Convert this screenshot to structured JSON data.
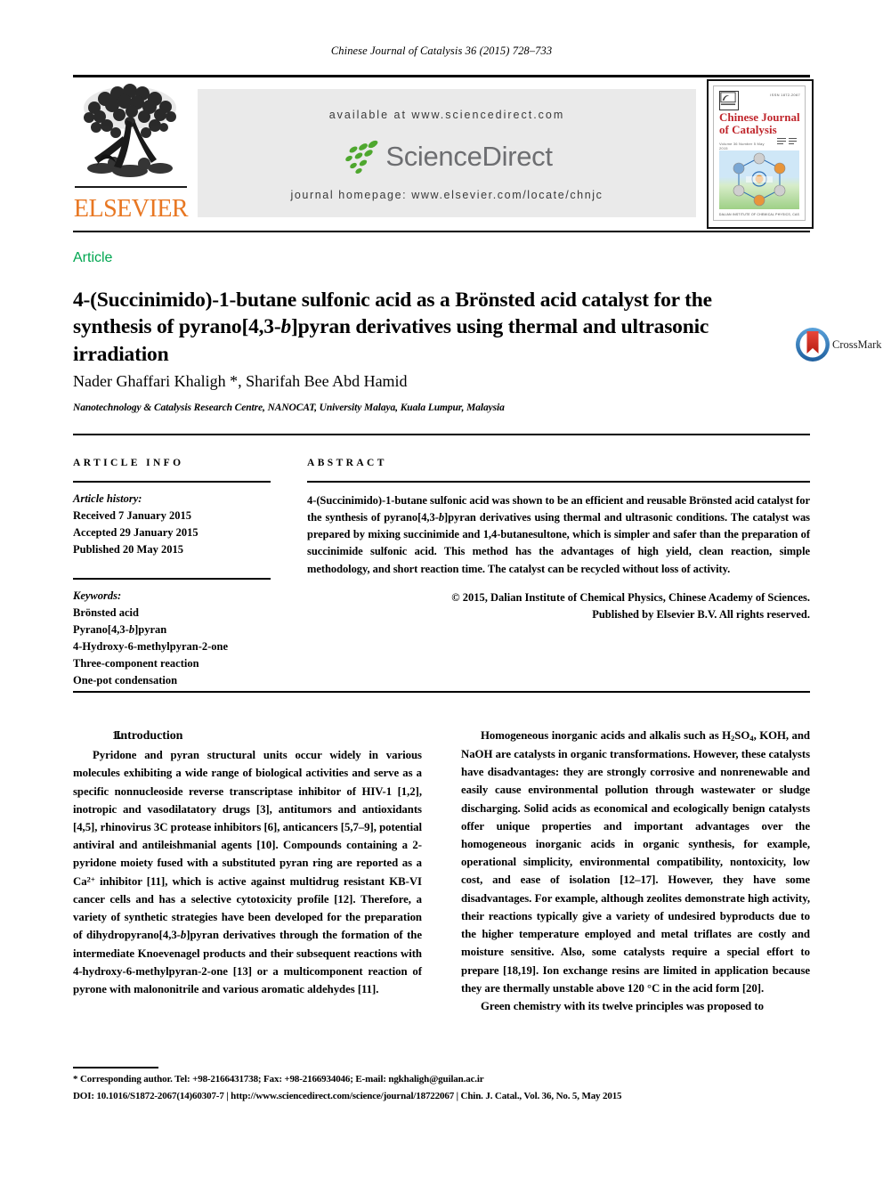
{
  "running_head": "Chinese Journal of Catalysis 36 (2015) 728–733",
  "masthead": {
    "publisher_name": "ELSEVIER",
    "available_at": "available at www.sciencedirect.com",
    "sciencedirect_wordmark": "ScienceDirect",
    "journal_homepage": "journal homepage: www.elsevier.com/locate/chnjc",
    "cover": {
      "title_line1": "Chinese Journal",
      "title_line2": "of Catalysis",
      "issue_line": "Volume 36  Number 5  May 2015",
      "top_right": "ISSN 1872-2067",
      "footer": "DALIAN INSTITUTE OF CHEMICAL PHYSICS, CAS"
    }
  },
  "article": {
    "type_label": "Article",
    "title_part1": "4-(Succinimido)-1-butane sulfonic acid as a Brönsted acid catalyst for the synthesis of pyrano[4,3-",
    "title_italic": "b",
    "title_part2": "]pyran derivatives using thermal and ultrasonic irradiation",
    "crossmark_label": "CrossMark",
    "authors": "Nader Ghaffari Khaligh *, Sharifah Bee Abd Hamid",
    "affiliation": "Nanotechnology & Catalysis Research Centre, NANOCAT, University Malaya, Kuala Lumpur, Malaysia"
  },
  "article_info": {
    "heading": "ARTICLE INFO",
    "history_label": "Article history:",
    "history": [
      "Received 7 January 2015",
      "Accepted 29 January 2015",
      "Published 20 May 2015"
    ],
    "keywords_label": "Keywords:",
    "keywords": [
      "Brönsted acid",
      "Pyrano[4,3-b]pyran",
      "4-Hydroxy-6-methylpyran-2-one",
      "Three-component reaction",
      "One-pot condensation"
    ]
  },
  "abstract": {
    "heading": "ABSTRACT",
    "body_part1": "4-(Succinimido)-1-butane sulfonic acid was shown to be an efficient and reusable Brönsted acid catalyst for the synthesis of pyrano[4,3-",
    "body_italic": "b",
    "body_part2": "]pyran derivatives using thermal and ultrasonic conditions. The catalyst was prepared by mixing succinimide and 1,4-butanesultone, which is simpler and safer than the preparation of succinimide sulfonic acid. This method has the advantages of high yield, clean reaction, simple methodology, and short reaction time. The catalyst can be recycled without loss of activity.",
    "copyright_line1": "© 2015, Dalian Institute of Chemical Physics, Chinese Academy of Sciences.",
    "copyright_line2": "Published by Elsevier B.V. All rights reserved."
  },
  "sections": {
    "intro_number": "1.",
    "intro_title": "Introduction"
  },
  "body": {
    "left_p1_a": "Pyridone and pyran structural units occur widely in various molecules exhibiting a wide range of biological activities and serve as a specific nonnucleoside reverse transcriptase inhibitor of HIV-1 [1,2], inotropic and vasodilatatory drugs [3], antitumors and antioxidants [4,5], rhinovirus 3C protease inhibitors [6], anticancers [5,7–9], potential antiviral and antileishmanial agents [10]. Compounds containing a 2-pyridone moiety fused with a substituted pyran ring are reported as a Ca",
    "left_p1_sup": "2+",
    "left_p1_b": " inhibitor [11], which is active against multidrug resistant KB-VI cancer cells and has a selective cytotoxicity profile [12]. Therefore, a variety of synthetic strategies have been developed for the preparation of dihydropyrano[4,3-",
    "left_p1_italic": "b",
    "left_p1_c": "]pyran derivatives through the formation of the intermediate Knoevenagel products and their subsequent reactions with 4-hydroxy-6-methylpyran-2-one [13] or a multicomponent reaction of pyrone with malononitrile and various aromatic aldehydes [11].",
    "right_p1_a": "Homogeneous inorganic acids and alkalis such as H",
    "right_p1_sub1": "2",
    "right_p1_b": "SO",
    "right_p1_sub2": "4",
    "right_p1_c": ", KOH, and NaOH are catalysts in organic transformations. However, these catalysts have disadvantages: they are strongly corrosive and nonrenewable and easily cause environmental pollution through wastewater or sludge discharging. Solid acids as economical and ecologically benign catalysts offer unique properties and important advantages over the homogeneous inorganic acids in organic synthesis, for example, operational simplicity, environmental compatibility, nontoxicity, low cost, and ease of isolation [12–17]. However, they have some disadvantages. For example, although zeolites demonstrate high activity, their reactions typically give a variety of undesired byproducts due to the higher temperature employed and metal triflates are costly and moisture sensitive. Also, some catalysts require a special effort to prepare [18,19]. Ion exchange resins are limited in application because they are thermally unstable above 120 °C in the acid form [20].",
    "right_p2": "Green chemistry with its twelve principles was proposed to"
  },
  "footer": {
    "corresponding": "* Corresponding author. Tel: +98-2166431738; Fax: +98-2166934046; E-mail: ngkhaligh@guilan.ac.ir",
    "doi_line": "DOI: 10.1016/S1872-2067(14)60307-7 | http://www.sciencedirect.com/science/journal/18722067 | Chin. J. Catal., Vol. 36, No. 5, May 2015"
  },
  "colors": {
    "article_label_green": "#00a650",
    "elsevier_orange": "#E87722",
    "sciencedirect_gray": "#6d6e71",
    "sciencedirect_green": "#4ea72e",
    "cover_red": "#c0272d",
    "crossmark_blue": "#2b74b8",
    "crossmark_red": "#d32a1e",
    "masthead_bg": "#eaeaea"
  }
}
